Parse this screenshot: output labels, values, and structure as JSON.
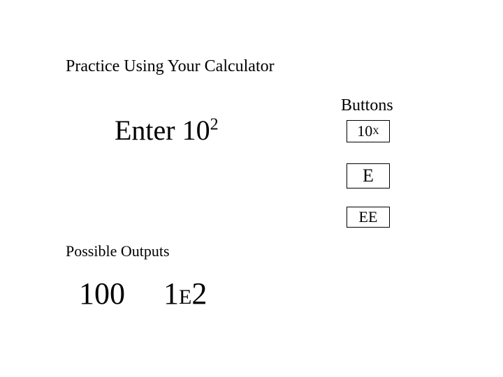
{
  "title": "Practice Using Your Calculator",
  "buttons_heading": "Buttons",
  "enter": {
    "prefix": "Enter 10",
    "sup": "2"
  },
  "buttons": {
    "tenx": {
      "base": "10",
      "sup": "X"
    },
    "e": "E",
    "ee": "EE"
  },
  "possible_outputs_heading": "Possible Outputs",
  "outputs": {
    "plain": "100",
    "sci": {
      "a": "1",
      "e": "E",
      "b": "2"
    }
  }
}
